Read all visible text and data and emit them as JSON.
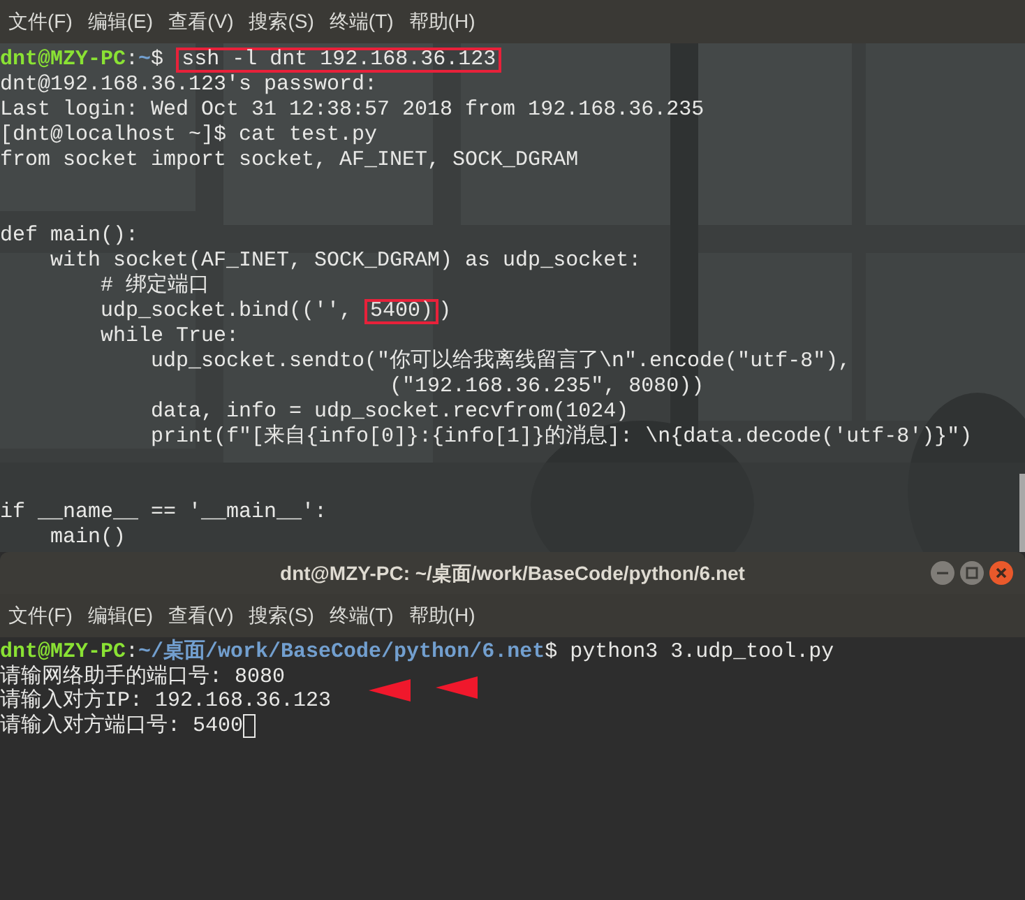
{
  "back_terminal": {
    "menu": [
      {
        "label": "文件(F)"
      },
      {
        "label": "编辑(E)"
      },
      {
        "label": "查看(V)"
      },
      {
        "label": "搜索(S)"
      },
      {
        "label": "终端(T)"
      },
      {
        "label": "帮助(H)"
      }
    ],
    "lines": [
      {
        "segments": [
          {
            "text": "dnt@MZY-PC",
            "kind": "user"
          },
          {
            "text": ":",
            "kind": "plain"
          },
          {
            "text": "~",
            "kind": "path"
          },
          {
            "text": "$ ",
            "kind": "plain"
          },
          {
            "text": "ssh -l dnt 192.168.36.123",
            "kind": "plain",
            "boxed": true
          }
        ]
      },
      {
        "segments": [
          {
            "text": "dnt@192.168.36.123's password:",
            "kind": "plain"
          }
        ]
      },
      {
        "segments": [
          {
            "text": "Last login: Wed Oct 31 12:38:57 2018 from 192.168.36.235",
            "kind": "plain"
          }
        ]
      },
      {
        "segments": [
          {
            "text": "[dnt@localhost ~]$ cat test.py",
            "kind": "plain"
          }
        ]
      },
      {
        "segments": [
          {
            "text": "from socket import socket, AF_INET, SOCK_DGRAM",
            "kind": "plain"
          }
        ]
      },
      {
        "kind": "blank"
      },
      {
        "kind": "blank"
      },
      {
        "segments": [
          {
            "text": "def main():",
            "kind": "plain"
          }
        ]
      },
      {
        "segments": [
          {
            "text": "    with socket(AF_INET, SOCK_DGRAM) as udp_socket:",
            "kind": "plain"
          }
        ]
      },
      {
        "segments": [
          {
            "text": "        # 绑定端口",
            "kind": "plain"
          }
        ]
      },
      {
        "segments": [
          {
            "text": "        udp_socket.bind(('', ",
            "kind": "plain"
          },
          {
            "text": "5400)",
            "kind": "plain",
            "boxed": true
          },
          {
            "text": ")",
            "kind": "plain"
          }
        ]
      },
      {
        "segments": [
          {
            "text": "        while True:",
            "kind": "plain"
          }
        ]
      },
      {
        "segments": [
          {
            "text": "            udp_socket.sendto(\"你可以给我离线留言了\\n\".encode(\"utf-8\"),",
            "kind": "plain"
          }
        ]
      },
      {
        "segments": [
          {
            "text": "                               (\"192.168.36.235\", 8080))",
            "kind": "plain"
          }
        ]
      },
      {
        "segments": [
          {
            "text": "            data, info = udp_socket.recvfrom(1024)",
            "kind": "plain"
          }
        ]
      },
      {
        "segments": [
          {
            "text": "            print(f\"[来自{info[0]}:{info[1]}的消息]: \\n{data.decode('utf-8')}\")",
            "kind": "plain"
          }
        ]
      },
      {
        "kind": "blank"
      },
      {
        "kind": "blank"
      },
      {
        "segments": [
          {
            "text": "if __name__ == '__main__':",
            "kind": "plain"
          }
        ]
      },
      {
        "segments": [
          {
            "text": "    main()",
            "kind": "plain"
          }
        ]
      }
    ]
  },
  "front_terminal": {
    "title": "dnt@MZY-PC: ~/桌面/work/BaseCode/python/6.net",
    "menu": [
      {
        "label": "文件(F)"
      },
      {
        "label": "编辑(E)"
      },
      {
        "label": "查看(V)"
      },
      {
        "label": "搜索(S)"
      },
      {
        "label": "终端(T)"
      },
      {
        "label": "帮助(H)"
      }
    ],
    "lines": [
      {
        "segments": [
          {
            "text": "dnt@MZY-PC",
            "kind": "user"
          },
          {
            "text": ":",
            "kind": "plain"
          },
          {
            "text": "~/桌面/work/BaseCode/python/6.net",
            "kind": "path"
          },
          {
            "text": "$ python3 3.udp_tool.py",
            "kind": "plain"
          }
        ]
      },
      {
        "segments": [
          {
            "text": "请输网络助手的端口号: 8080",
            "kind": "plain"
          }
        ]
      },
      {
        "segments": [
          {
            "text": "请输入对方IP: 192.168.36.123",
            "kind": "plain"
          }
        ]
      },
      {
        "segments": [
          {
            "text": "请输入对方端口号: 5400",
            "kind": "plain"
          }
        ],
        "cursor": true
      }
    ]
  }
}
